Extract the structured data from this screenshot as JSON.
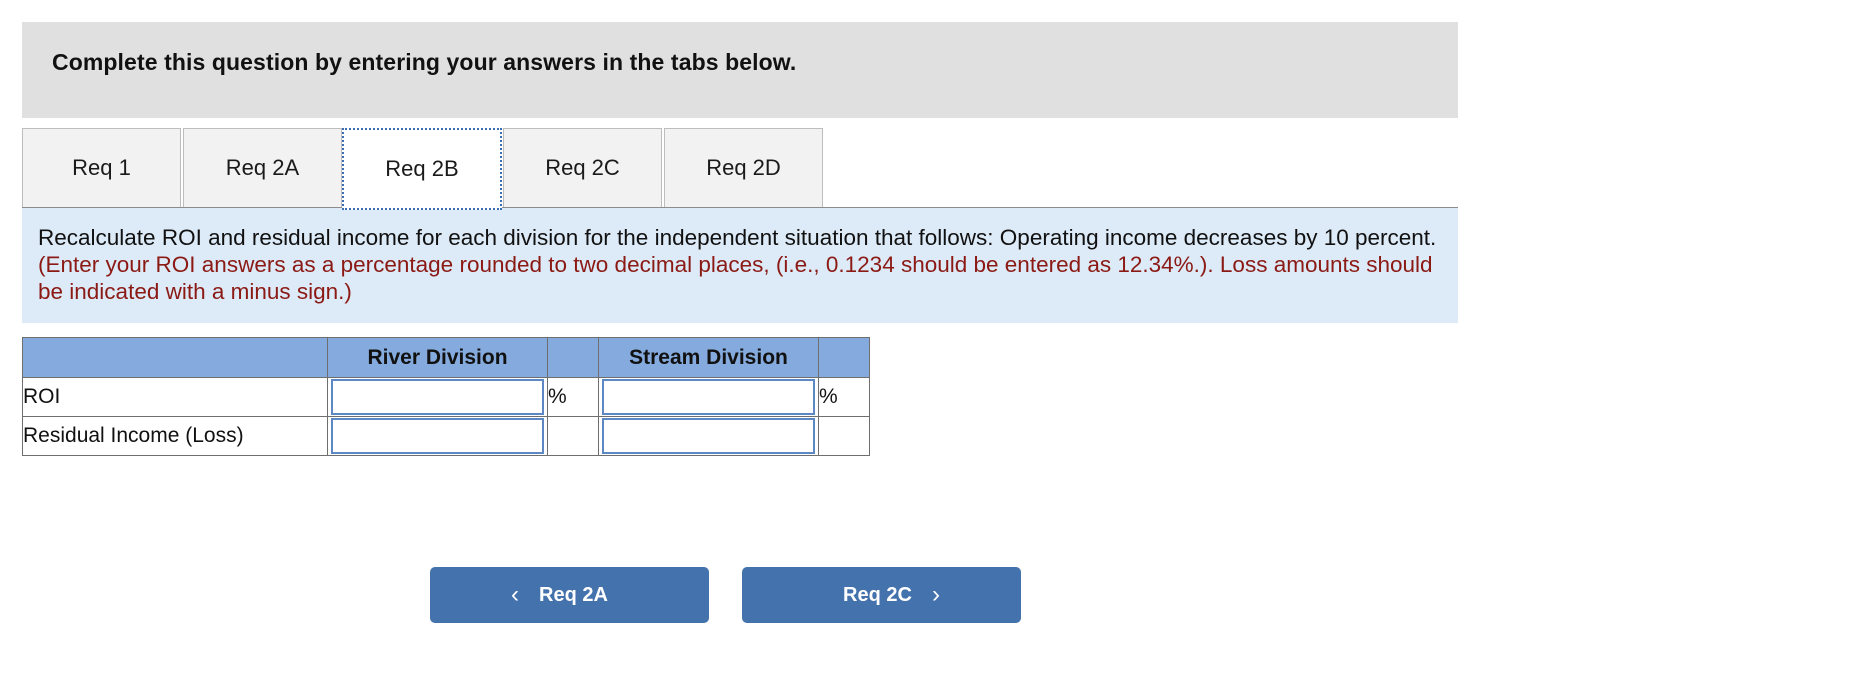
{
  "header": {
    "banner_text": "Complete this question by entering your answers in the tabs below."
  },
  "tabs": [
    {
      "label": "Req 1",
      "active": false
    },
    {
      "label": "Req 2A",
      "active": false
    },
    {
      "label": "Req 2B",
      "active": true
    },
    {
      "label": "Req 2C",
      "active": false
    },
    {
      "label": "Req 2D",
      "active": false
    }
  ],
  "instruction": {
    "main": "Recalculate ROI and residual income for each division for the independent situation that follows: Operating income decreases by 10 percent. ",
    "hint": "(Enter your ROI answers as a percentage rounded to two decimal places, (i.e., 0.1234 should be entered as 12.34%.). Loss amounts should be indicated with a minus sign.)"
  },
  "table": {
    "headers": [
      "",
      "River Division",
      "",
      "Stream Division",
      ""
    ],
    "rows": [
      {
        "label": "ROI",
        "river_value": "",
        "river_unit": "%",
        "stream_value": "",
        "stream_unit": "%"
      },
      {
        "label": "Residual Income (Loss)",
        "river_value": "",
        "river_unit": "",
        "stream_value": "",
        "stream_unit": ""
      }
    ]
  },
  "footer": {
    "prev_label": "Req 2A",
    "next_label": "Req 2C",
    "prev_icon": "chevron-left-icon",
    "next_icon": "chevron-right-icon",
    "prev_glyph": "‹",
    "next_glyph": "›"
  },
  "colors": {
    "banner_bg": "#e0e0e0",
    "instruction_bg": "#ddeaf7",
    "hint_text": "#8b1a14",
    "table_header_bg": "#85aadd",
    "button_bg": "#4472ad",
    "active_tab_border": "#3c6eb4"
  }
}
